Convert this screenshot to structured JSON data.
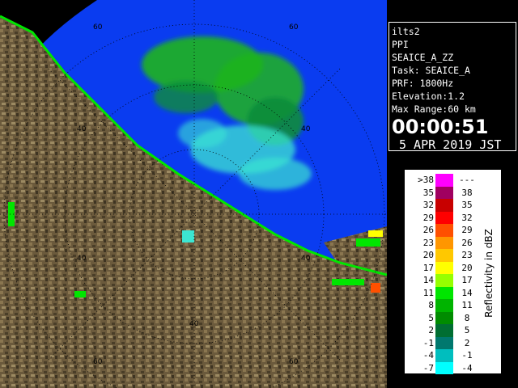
{
  "info": {
    "station": "ilts2",
    "mode": "PPI",
    "product": "SEAICE_A_ZZ",
    "task": "Task: SEAICE_A",
    "prf": "PRF: 1800Hz",
    "elevation": "Elevation:1.2",
    "max_range": "Max Range:60 km",
    "time": "00:00:51",
    "date": "5 APR 2019 JST"
  },
  "scale": {
    "title": "Reflectivity in dBZ",
    "rows": [
      {
        "lo": ">38",
        "hi": "---",
        "color": "#ff00ff"
      },
      {
        "lo": "35",
        "hi": "38",
        "color": "#a00060"
      },
      {
        "lo": "32",
        "hi": "35",
        "color": "#c80000"
      },
      {
        "lo": "29",
        "hi": "32",
        "color": "#ff0000"
      },
      {
        "lo": "26",
        "hi": "29",
        "color": "#ff5000"
      },
      {
        "lo": "23",
        "hi": "26",
        "color": "#ff9600"
      },
      {
        "lo": "20",
        "hi": "23",
        "color": "#ffc800"
      },
      {
        "lo": "17",
        "hi": "20",
        "color": "#ffff00"
      },
      {
        "lo": "14",
        "hi": "17",
        "color": "#96ff00"
      },
      {
        "lo": "11",
        "hi": "14",
        "color": "#00e600"
      },
      {
        "lo": "8",
        "hi": "11",
        "color": "#00b400"
      },
      {
        "lo": "5",
        "hi": "8",
        "color": "#008c00"
      },
      {
        "lo": "2",
        "hi": "5",
        "color": "#006e32"
      },
      {
        "lo": "-1",
        "hi": "2",
        "color": "#00786e"
      },
      {
        "lo": "-4",
        "hi": "-1",
        "color": "#00bebe"
      },
      {
        "lo": "-7",
        "hi": "-4",
        "color": "#00ffff"
      }
    ]
  },
  "map": {
    "range_labels": [
      "60",
      "60",
      "40",
      "40",
      "40",
      "40",
      "40",
      "60",
      "60"
    ],
    "colors": {
      "sea": "#0a3cf0",
      "land": "#6b5a3c",
      "echo_light": "#1eb41e",
      "echo_dark": "#0a8c3c",
      "echo_cyan": "#3ce6d2"
    }
  }
}
